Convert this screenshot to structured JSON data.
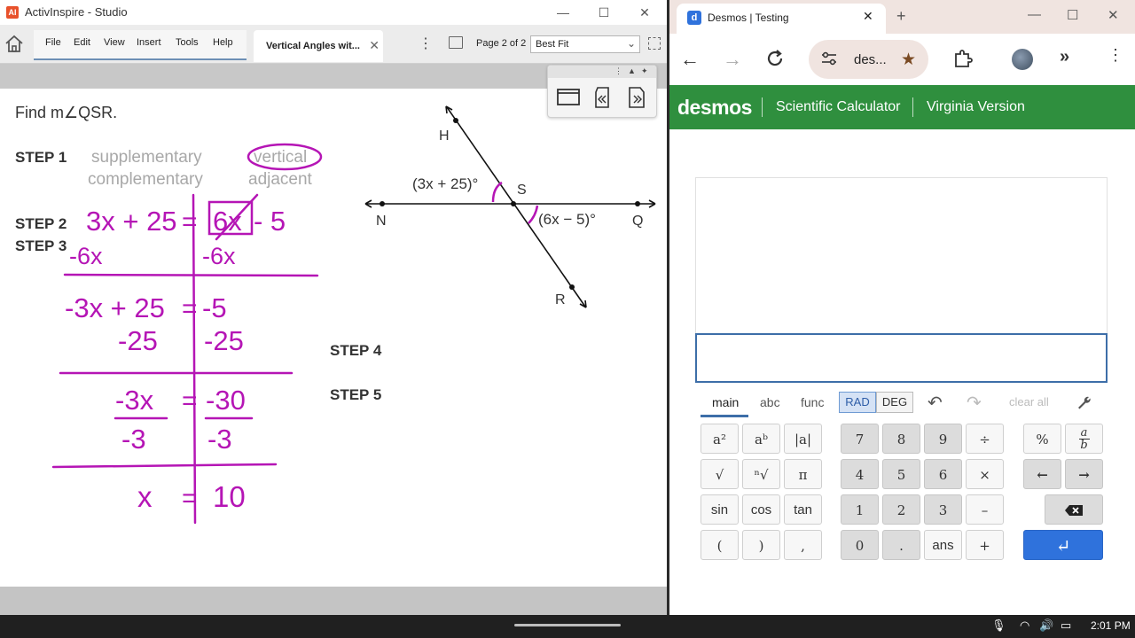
{
  "activinspire": {
    "window_title": "ActivInspire - Studio",
    "app_icon_letter": "AI",
    "menus": [
      "File",
      "Edit",
      "View",
      "Insert",
      "Tools",
      "Help"
    ],
    "tab_label": "Vertical Angles wit...",
    "page_label": "Page 2 of 2",
    "zoom_value": "Best Fit"
  },
  "lesson": {
    "prompt": "Find m∠QSR.",
    "step1_label": "STEP 1",
    "step2_label": "STEP 2",
    "step3_label": "STEP 3",
    "step4_label": "STEP 4",
    "step5_label": "STEP 5",
    "choices": {
      "supplementary": "supplementary",
      "vertical": "vertical",
      "complementary": "complementary",
      "adjacent": "adjacent"
    },
    "diagram": {
      "label_H": "H",
      "label_S": "S",
      "label_N": "N",
      "label_Q": "Q",
      "label_R": "R",
      "angle_upper": "(3x + 25)°",
      "angle_lower": "(6x − 5)°"
    },
    "work": {
      "row1_left": "3x + 25",
      "row1_right_boxed": "6x",
      "row1_right_tail": "- 5",
      "row2_left": "-6x",
      "row2_right": "-6x",
      "row3_left": "-3x + 25",
      "row3_right": "-5",
      "row4_left": "-25",
      "row4_right": "-25",
      "row5_left": "-3x",
      "row5_right": "-30",
      "row6_left": "-3",
      "row6_right": "-3",
      "row7_left": "x",
      "row7_right": "10"
    }
  },
  "chrome": {
    "tab_title": "Desmos | Testing",
    "favicon_letter": "d",
    "url": "des...",
    "more_label": "»"
  },
  "desmos": {
    "logo": "desmos",
    "header_item1": "Scientific Calculator",
    "header_item2": "Virginia Version",
    "tabs": {
      "main": "main",
      "abc": "abc",
      "func": "func",
      "rad": "RAD",
      "deg": "DEG",
      "clear_all": "clear all"
    },
    "keys": {
      "sq": "a²",
      "pow": "aᵇ",
      "abs": "|a|",
      "sqrt": "√",
      "nroot": "ⁿ√",
      "pi": "π",
      "sin": "sin",
      "cos": "cos",
      "tan": "tan",
      "lparen": "(",
      "rparen": ")",
      "comma": ",",
      "k7": "7",
      "k8": "8",
      "k9": "9",
      "div": "÷",
      "k4": "4",
      "k5": "5",
      "k6": "6",
      "mul": "×",
      "k1": "1",
      "k2": "2",
      "k3": "3",
      "minus": "–",
      "k0": "0",
      "dot": ".",
      "ans": "ans",
      "plus": "+",
      "percent": "%",
      "frac_num": "a",
      "frac_den": "b",
      "left": "←",
      "right": "→",
      "enter": "↵"
    }
  },
  "taskbar": {
    "time": "2:01 PM"
  },
  "colors": {
    "ink": "#b515b5",
    "desmos_green": "#2f8f3e",
    "desmos_blue": "#2f72dc"
  }
}
